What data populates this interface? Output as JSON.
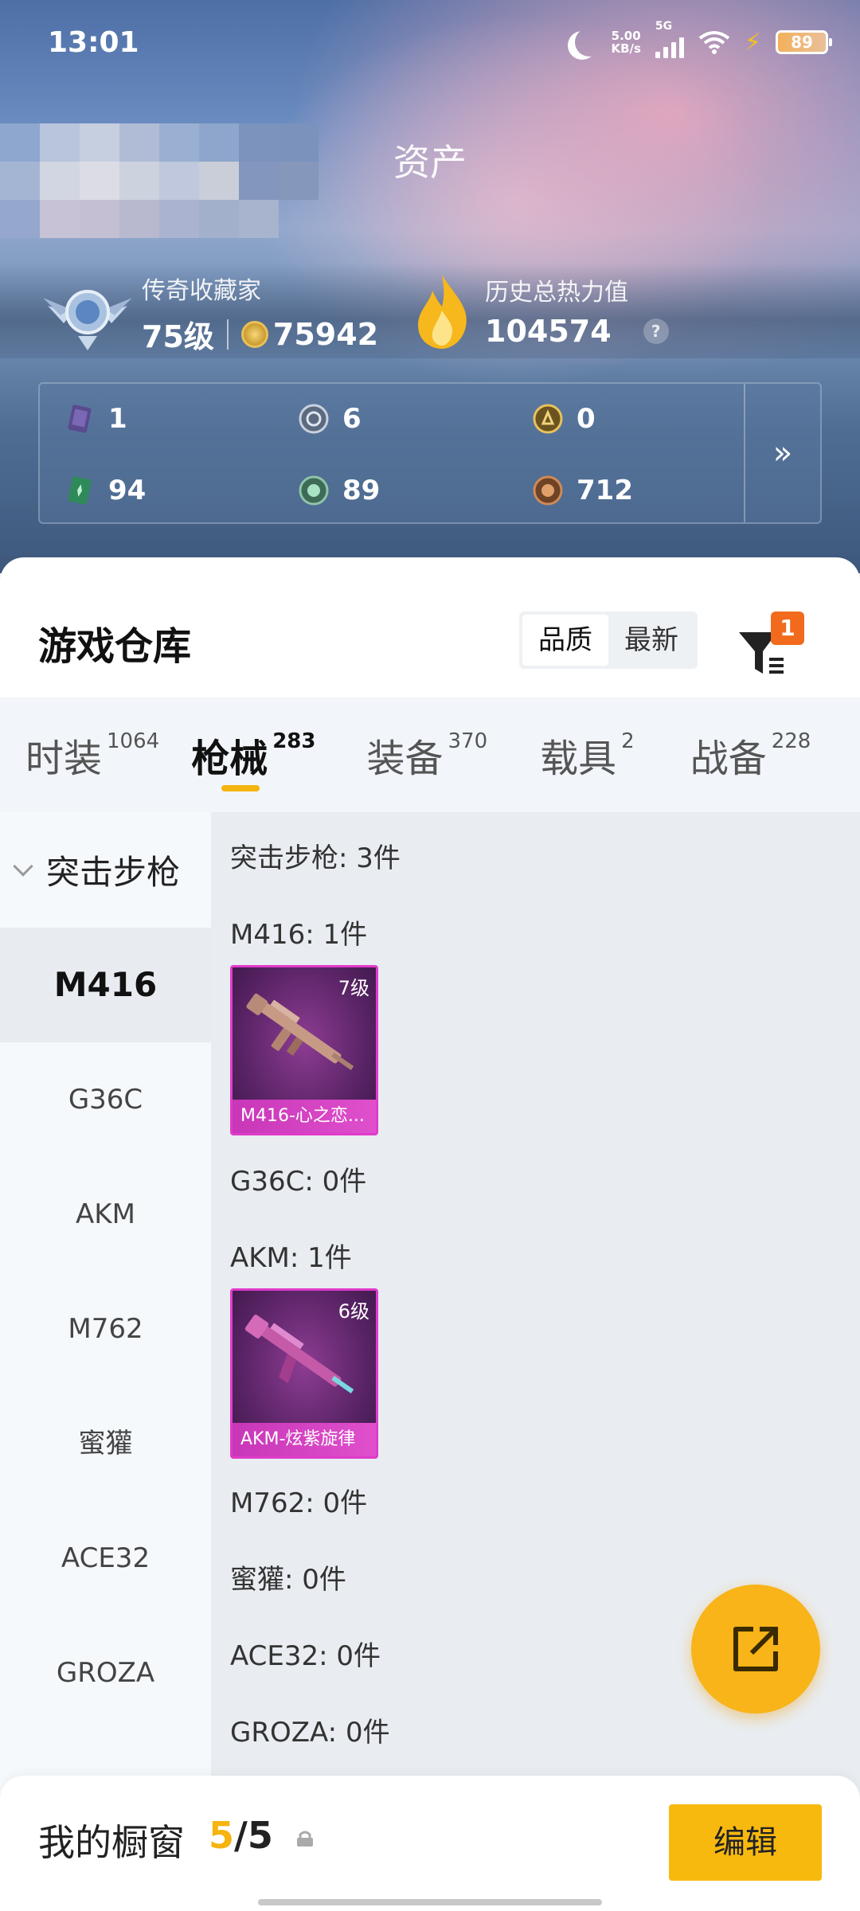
{
  "status_bar": {
    "time": "13:01",
    "net_speed_value": "5.00",
    "net_speed_unit": "KB/s",
    "network": "5G",
    "battery": "89"
  },
  "header": {
    "title": "资产"
  },
  "profile": {
    "rank_title": "传奇收藏家",
    "level": "75级",
    "coins": "75942",
    "heat_label": "历史总热力值",
    "heat_value": "104574",
    "help": "?"
  },
  "assets": [
    {
      "icon": "purple-card-icon",
      "value": "1"
    },
    {
      "icon": "silver-medal-icon",
      "value": "6"
    },
    {
      "icon": "gold-medal-icon",
      "value": "0"
    },
    {
      "icon": "green-card-icon",
      "value": "94"
    },
    {
      "icon": "green-orb-icon",
      "value": "89"
    },
    {
      "icon": "bronze-orb-icon",
      "value": "712"
    }
  ],
  "warehouse": {
    "title": "游戏仓库",
    "sort_options": [
      "品质",
      "最新"
    ],
    "filter_count": "1",
    "tabs": [
      {
        "label": "时装",
        "count": "1064"
      },
      {
        "label": "枪械",
        "count": "283"
      },
      {
        "label": "装备",
        "count": "370"
      },
      {
        "label": "载具",
        "count": "2"
      },
      {
        "label": "战备",
        "count": "228"
      }
    ],
    "category": "突击步枪",
    "side_items": [
      "M416",
      "G36C",
      "AKM",
      "M762",
      "蜜獾",
      "ACE32",
      "GROZA"
    ],
    "summary": "突击步枪: 3件",
    "groups": [
      {
        "label": "M416: 1件"
      },
      {
        "label": "G36C: 0件"
      },
      {
        "label": "AKM: 1件"
      },
      {
        "label": "M762: 0件"
      },
      {
        "label": "蜜獾: 0件"
      },
      {
        "label": "ACE32: 0件"
      },
      {
        "label": "GROZA: 0件"
      }
    ],
    "weapons": [
      {
        "level": "7级",
        "name": "M416-心之恋..."
      },
      {
        "level": "6级",
        "name": "AKM-炫紫旋律"
      }
    ]
  },
  "showcase": {
    "title": "我的橱窗",
    "current": "5",
    "total": "/5",
    "edit_label": "编辑"
  },
  "colors": {
    "accent": "#f8b418",
    "weapon_border": "#e03bc9",
    "filter_badge": "#f26a1b"
  }
}
